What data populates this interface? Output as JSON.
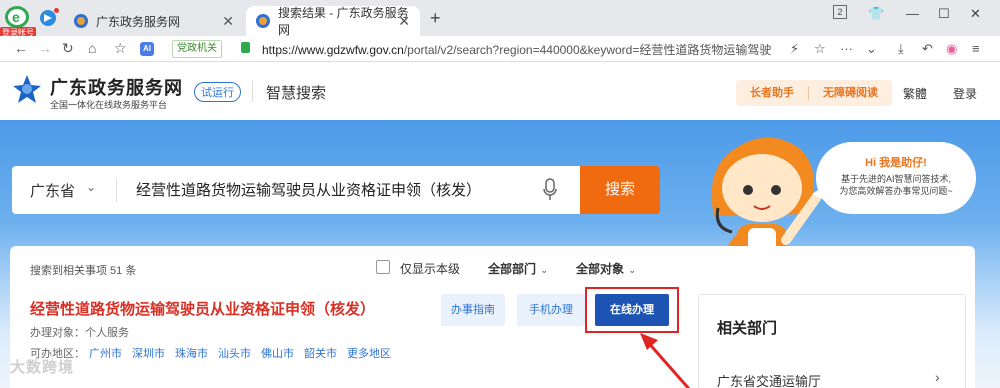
{
  "browser": {
    "login_badge": "登录帐号",
    "tabs": [
      {
        "title": "广东政务服务网"
      },
      {
        "title": "搜索结果 - 广东政务服务网"
      }
    ],
    "window_badge": "2",
    "url_host": "https://www.gdzwfw.gov.cn",
    "url_path": "/portal/v2/search?region=440000&keyword=经营性道路货物运输驾驶",
    "gov_badge": "党政机关",
    "ai_chip": "AI"
  },
  "header": {
    "site_name": "广东政务服务网",
    "site_sub": "全国一体化在线政务服务平台",
    "trial": "试运行",
    "smart_search": "智慧搜索",
    "elder_helper": "长者助手",
    "accessible_read": "无障碍阅读",
    "traditional": "繁體",
    "login": "登录"
  },
  "search": {
    "region": "广东省",
    "query": "经营性道路货物运输驾驶员从业资格证申领（核发）",
    "button": "搜索"
  },
  "assistant": {
    "title": "Hi 我是助仔!",
    "line1": "基于先进的AI智慧问答技术,",
    "line2": "为您高效解答办事常见问题~"
  },
  "results": {
    "count_text": "搜索到相关事项 51 条",
    "only_level": "仅显示本级",
    "all_departments": "全部部门",
    "all_targets": "全部对象",
    "item": {
      "title": "经营性道路货物运输驾驶员从业资格证申领（核发）",
      "target": "办理对象：个人服务",
      "area_label": "可办地区：",
      "areas": [
        "广州市",
        "深圳市",
        "珠海市",
        "汕头市",
        "佛山市",
        "韶关市",
        "更多地区"
      ],
      "guide": "办事指南",
      "mobile": "手机办理",
      "online": "在线办理"
    }
  },
  "related": {
    "title": "相关部门",
    "dept": "广东省交通运输厅"
  },
  "watermark": "大数跨境"
}
